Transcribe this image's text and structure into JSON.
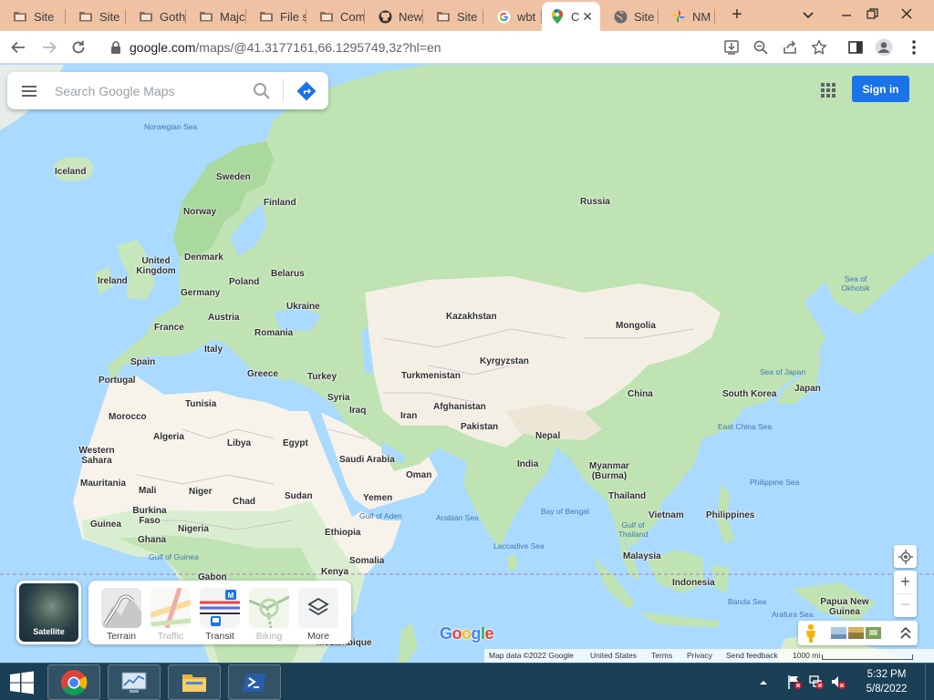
{
  "browser": {
    "tabs": [
      {
        "title": "Site",
        "icon": "folder-icon"
      },
      {
        "title": "Site",
        "icon": "folder-icon"
      },
      {
        "title": "Goth",
        "icon": "folder-icon"
      },
      {
        "title": "Majc",
        "icon": "folder-icon"
      },
      {
        "title": "File s",
        "icon": "folder-icon"
      },
      {
        "title": "Com",
        "icon": "folder-icon"
      },
      {
        "title": "New",
        "icon": "github-icon"
      },
      {
        "title": "Site",
        "icon": "folder-icon"
      },
      {
        "title": "wbt",
        "icon": "google-icon"
      },
      {
        "title": "C",
        "icon": "maps-pin-icon",
        "active": true
      },
      {
        "title": "Site",
        "icon": "globe-icon"
      },
      {
        "title": "NM",
        "icon": "pinwheel-icon"
      }
    ],
    "new_tab": "+",
    "url_main": "google.com",
    "url_rest": "/maps/@41.3177161,66.1295749,3z?hl=en"
  },
  "maps": {
    "search_placeholder": "Search Google Maps",
    "sign_in": "Sign in",
    "satellite_label": "Satellite",
    "layers": [
      {
        "label": "Terrain",
        "enabled": true
      },
      {
        "label": "Traffic",
        "enabled": false
      },
      {
        "label": "Transit",
        "enabled": true
      },
      {
        "label": "Biking",
        "enabled": false
      },
      {
        "label": "More",
        "enabled": true
      }
    ],
    "zoom_in": "+",
    "zoom_out": "−",
    "logo": [
      "G",
      "o",
      "o",
      "g",
      "l",
      "e"
    ],
    "logo_colors": [
      "#4285f4",
      "#ea4335",
      "#fbbc05",
      "#4285f4",
      "#34a853",
      "#ea4335"
    ],
    "footer": {
      "map_data": "Map data ©2022 Google",
      "region": "United States",
      "terms": "Terms",
      "privacy": "Privacy",
      "feedback": "Send feedback",
      "scale": "1000 mi"
    },
    "countries": [
      "Iceland",
      "Sweden",
      "Finland",
      "Norway",
      "Russia",
      "Denmark",
      "United Kingdom",
      "Ireland",
      "Belarus",
      "Poland",
      "Germany",
      "Ukraine",
      "Austria",
      "France",
      "Romania",
      "Kazakhstan",
      "Mongolia",
      "Italy",
      "Spain",
      "Portugal",
      "Greece",
      "Turkey",
      "Turkmenistan",
      "Kyrgyzstan",
      "Tunisia",
      "Syria",
      "Iraq",
      "Iran",
      "Afghanistan",
      "Morocco",
      "Algeria",
      "Libya",
      "Egypt",
      "Pakistan",
      "China",
      "South Korea",
      "Japan",
      "Western Sahara",
      "Nepal",
      "Saudi Arabia",
      "Oman",
      "India",
      "Myanmar (Burma)",
      "Mauritania",
      "Mali",
      "Niger",
      "Chad",
      "Sudan",
      "Yemen",
      "Thailand",
      "Burkina Faso",
      "Guinea",
      "Nigeria",
      "Ghana",
      "Ethiopia",
      "Vietnam",
      "Philippines",
      "Somalia",
      "Malaysia",
      "Kenya",
      "Gabon",
      "Indonesia",
      "Papua New Guinea",
      "Mozambique"
    ],
    "seas": [
      "Norwegian Sea",
      "Sea of Okhotsk",
      "Sea of Japan",
      "East China Sea",
      "Philippine Sea",
      "Arabian Sea",
      "Bay of Bengal",
      "Gulf of Aden",
      "Laccadive Sea",
      "Gulf of Thailand",
      "Gulf of Guinea",
      "Banda Sea",
      "Arafura Sea"
    ]
  },
  "taskbar": {
    "time": "5:32 PM",
    "date": "5/8/2022"
  },
  "colors": {
    "tab_strip": "#f0c2a4",
    "water": "#aadaff",
    "land_green": "#bfe3b3",
    "land_desert": "#f7f3ea",
    "accent_blue": "#1a73e8",
    "taskbar": "#1b3f55"
  }
}
